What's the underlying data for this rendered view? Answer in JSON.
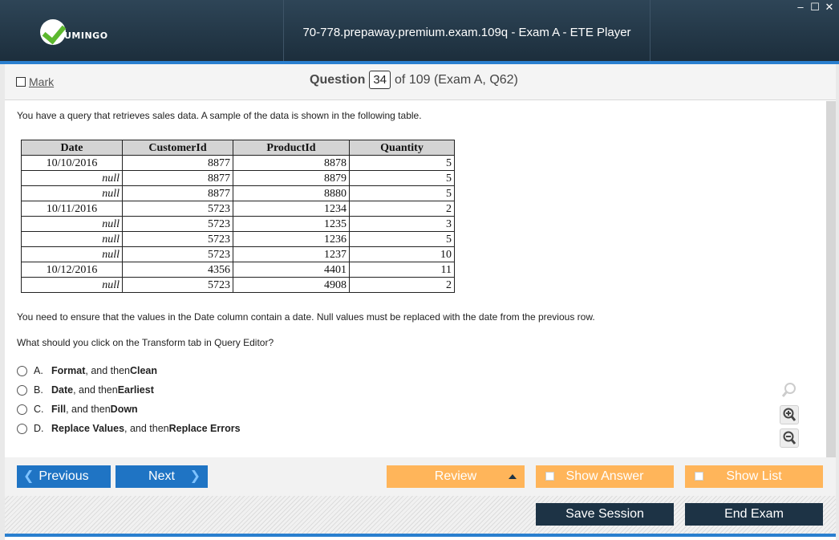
{
  "window": {
    "title": "70-778.prepaway.premium.exam.109q - Exam A - ETE Player",
    "logo_text": "UMINGO",
    "controls": {
      "minimize": "–",
      "maximize": "☐",
      "close": "✕"
    }
  },
  "header": {
    "mark_label": "Mark",
    "question_label": "Question",
    "question_number": "34",
    "question_of": "of 109 (Exam A, Q62)"
  },
  "question": {
    "intro": "You have a query that retrieves sales data. A sample of the data is shown in the following table.",
    "table": {
      "headers": [
        "Date",
        "CustomerId",
        "ProductId",
        "Quantity"
      ],
      "rows": [
        [
          "10/10/2016",
          "8877",
          "8878",
          "5"
        ],
        [
          "null",
          "8877",
          "8879",
          "5"
        ],
        [
          "null",
          "8877",
          "8880",
          "5"
        ],
        [
          "10/11/2016",
          "5723",
          "1234",
          "2"
        ],
        [
          "null",
          "5723",
          "1235",
          "3"
        ],
        [
          "null",
          "5723",
          "1236",
          "5"
        ],
        [
          "null",
          "5723",
          "1237",
          "10"
        ],
        [
          "10/12/2016",
          "4356",
          "4401",
          "11"
        ],
        [
          "null",
          "5723",
          "4908",
          "2"
        ]
      ]
    },
    "requirement": "You need to ensure that the values in the Date column contain a date. Null values must be replaced with the date from the previous row.",
    "prompt": "What should you click on the Transform tab in Query Editor?",
    "options": [
      {
        "letter": "A.",
        "first": "Format",
        "middle": ", and then ",
        "second": "Clean"
      },
      {
        "letter": "B.",
        "first": "Date",
        "middle": ", and then ",
        "second": "Earliest"
      },
      {
        "letter": "C.",
        "first": "Fill",
        "middle": ", and then ",
        "second": "Down"
      },
      {
        "letter": "D.",
        "first": "Replace Values",
        "middle": ", and then ",
        "second": "Replace Errors"
      }
    ]
  },
  "nav": {
    "previous": "Previous",
    "next": "Next",
    "review": "Review",
    "show_answer": "Show Answer",
    "show_list": "Show List",
    "save_session": "Save Session",
    "end_exam": "End Exam"
  },
  "icons": {
    "zoom_search": "search-icon",
    "zoom_in": "zoom-in-icon",
    "zoom_out": "zoom-out-icon"
  },
  "colors": {
    "title_bar": "#1c2e3c",
    "accent_blue": "#1f74c4",
    "button_orange": "#ffb55a",
    "button_dark": "#1d3345",
    "logo_green": "#5cb82e"
  }
}
